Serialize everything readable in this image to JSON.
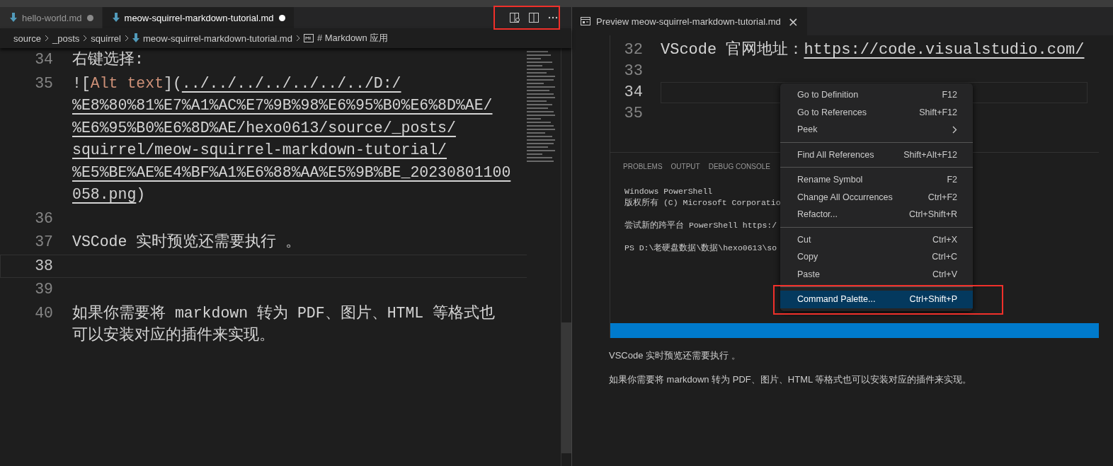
{
  "editor": {
    "tabs": [
      {
        "label": "hello-world.md",
        "selected": false,
        "dirty": true
      },
      {
        "label": "meow-squirrel-markdown-tutorial.md",
        "selected": true,
        "dirty": true
      }
    ],
    "actions_highlighted": true,
    "breadcrumbs": [
      {
        "label": "source",
        "kind": "folder"
      },
      {
        "label": "_posts",
        "kind": "folder"
      },
      {
        "label": "squirrel",
        "kind": "folder"
      },
      {
        "label": "meow-squirrel-markdown-tutorial.md",
        "kind": "file"
      },
      {
        "label": "# Markdown 应用",
        "kind": "symbol"
      }
    ],
    "lines": [
      {
        "number": "34",
        "kind": "text",
        "text": "右键选择:",
        "current": false
      },
      {
        "number": "35",
        "kind": "image",
        "prefix": "![",
        "alt": "Alt text",
        "middle": "](",
        "url_lines": [
          "../../../../../../../D:/",
          "%E8%80%81%E7%A1%AC%E7%9B%98%E6%95%B0%E6%8D%AE/",
          "%E6%95%B0%E6%8D%AE/hexo0613/source/_posts/",
          "squirrel/meow-squirrel-markdown-tutorial/",
          "%E5%BE%AE%E4%BF%A1%E6%88%AA%E5%9B%BE_20230801100",
          "058.png"
        ],
        "suffix": ")",
        "current": false
      },
      {
        "number": "36",
        "kind": "blank",
        "current": false
      },
      {
        "number": "37",
        "kind": "text",
        "text": "VSCode 实时预览还需要执行 。",
        "current": false
      },
      {
        "number": "38",
        "kind": "blank",
        "current": true
      },
      {
        "number": "39",
        "kind": "blank",
        "current": false
      },
      {
        "number": "40",
        "kind": "text",
        "text": "如果你需要将 markdown 转为 PDF、图片、HTML 等格式也可以安装对应的插件来实现。",
        "current": false
      }
    ]
  },
  "preview": {
    "tab": {
      "label": "Preview meow-squirrel-markdown-tutorial.md",
      "close": "×"
    },
    "screenshot": {
      "code_lines": [
        {
          "number": "32",
          "text": "VScode 官网地址：",
          "link": "https://code.visualstudio.com/",
          "current": false
        },
        {
          "number": "33",
          "current": false
        },
        {
          "number": "34",
          "current": true
        },
        {
          "number": "35",
          "current": false
        }
      ],
      "panel_tabs": [
        "PROBLEMS",
        "OUTPUT",
        "DEBUG CONSOLE"
      ],
      "terminal_blocks": [
        [
          "Windows PowerShell",
          "版权所有 (C) Microsoft Corporatio"
        ],
        [
          "尝试新的跨平台 PowerShell https:/"
        ],
        [
          "PS D:\\老硬盘数据\\数据\\hexo0613\\so"
        ]
      ],
      "context_menu": [
        {
          "kind": "action",
          "label": "Go to Definition",
          "shortcut": "F12",
          "selected": false,
          "highlighted": false
        },
        {
          "kind": "action",
          "label": "Go to References",
          "shortcut": "Shift+F12",
          "selected": false,
          "highlighted": false
        },
        {
          "kind": "submenu",
          "label": "Peek",
          "selected": false,
          "highlighted": false
        },
        {
          "kind": "separator"
        },
        {
          "kind": "action",
          "label": "Find All References",
          "shortcut": "Shift+Alt+F12",
          "selected": false,
          "highlighted": false
        },
        {
          "kind": "separator"
        },
        {
          "kind": "action",
          "label": "Rename Symbol",
          "shortcut": "F2",
          "selected": false,
          "highlighted": false
        },
        {
          "kind": "action",
          "label": "Change All Occurrences",
          "shortcut": "Ctrl+F2",
          "selected": false,
          "highlighted": false
        },
        {
          "kind": "action",
          "label": "Refactor...",
          "shortcut": "Ctrl+Shift+R",
          "selected": false,
          "highlighted": false
        },
        {
          "kind": "separator"
        },
        {
          "kind": "action",
          "label": "Cut",
          "shortcut": "Ctrl+X",
          "selected": false,
          "highlighted": false
        },
        {
          "kind": "action",
          "label": "Copy",
          "shortcut": "Ctrl+C",
          "selected": false,
          "highlighted": false
        },
        {
          "kind": "action",
          "label": "Paste",
          "shortcut": "Ctrl+V",
          "selected": false,
          "highlighted": false
        },
        {
          "kind": "separator"
        },
        {
          "kind": "action",
          "label": "Command Palette...",
          "shortcut": "Ctrl+Shift+P",
          "selected": true,
          "highlighted": true
        }
      ]
    },
    "paragraphs": [
      "VSCode 实时预览还需要执行 。",
      "如果你需要将 markdown 转为 PDF、图片、HTML 等格式也可以安装对应的插件来实现。"
    ]
  }
}
